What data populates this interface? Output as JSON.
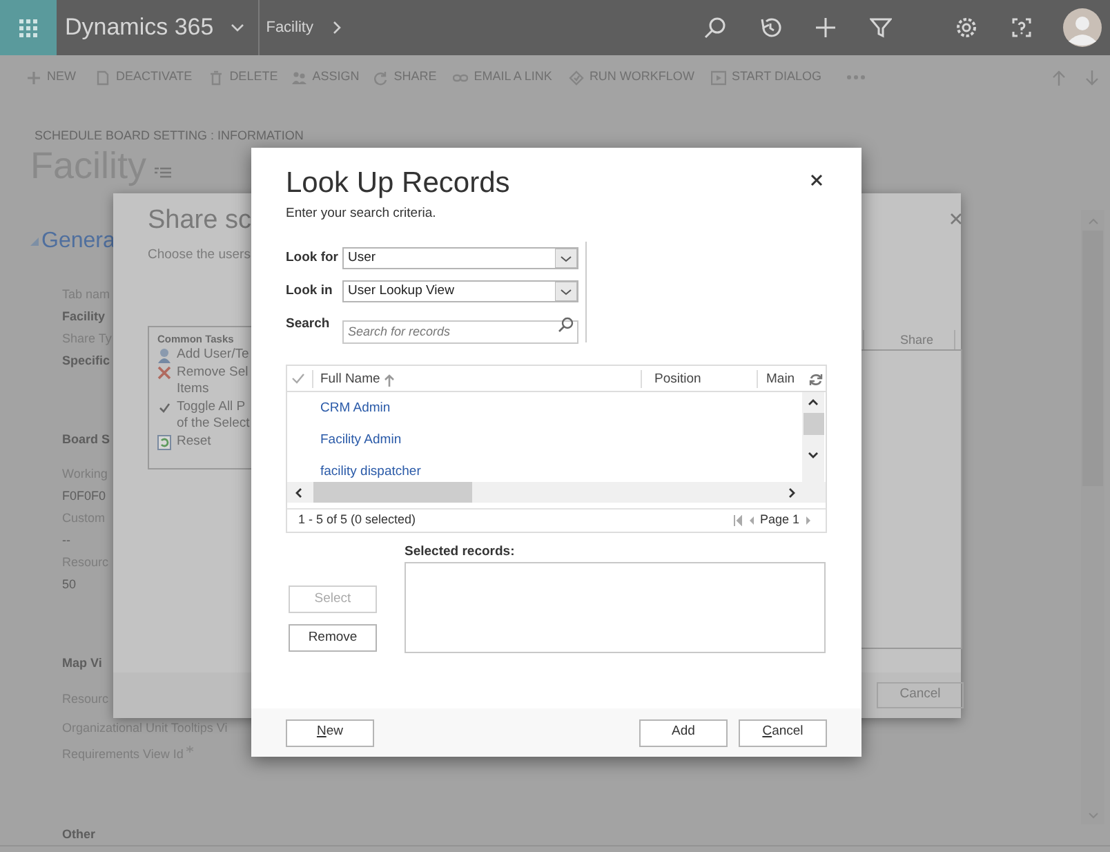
{
  "nav": {
    "app_title": "Dynamics 365",
    "breadcrumb": "Facility"
  },
  "command_bar": [
    {
      "label": "NEW"
    },
    {
      "label": "DEACTIVATE"
    },
    {
      "label": "DELETE"
    },
    {
      "label": "ASSIGN"
    },
    {
      "label": "SHARE"
    },
    {
      "label": "EMAIL A LINK"
    },
    {
      "label": "RUN WORKFLOW"
    },
    {
      "label": "START DIALOG"
    }
  ],
  "record": {
    "entity": "SCHEDULE BOARD SETTING : INFORMATION",
    "title": "Facility",
    "section": "Genera"
  },
  "form_fields": [
    {
      "text": "Tab nam",
      "kind": "label"
    },
    {
      "text": "Facility",
      "kind": "value"
    },
    {
      "text": "Share Ty",
      "kind": "label"
    },
    {
      "text": "Specific",
      "kind": "value"
    },
    {
      "text": "Board S",
      "kind": "heading"
    },
    {
      "text": "Working",
      "kind": "label"
    },
    {
      "text": "F0F0F0",
      "kind": "plain"
    },
    {
      "text": "Custom",
      "kind": "label"
    },
    {
      "text": "--",
      "kind": "plain"
    },
    {
      "text": "Resourc",
      "kind": "label"
    },
    {
      "text": "50",
      "kind": "plain"
    },
    {
      "text": "Map Vi",
      "kind": "heading"
    },
    {
      "text": "Resourc",
      "kind": "label"
    },
    {
      "text": "Organizational Unit Tooltips Vi",
      "kind": "label"
    },
    {
      "text": "Requirements View Id",
      "kind": "required"
    },
    {
      "text": "Other",
      "kind": "heading"
    }
  ],
  "share_dialog": {
    "title": "Share sc",
    "instruction": "Choose the users",
    "common_tasks": {
      "title": "Common Tasks",
      "items": [
        {
          "lines": [
            "Add User/Te"
          ]
        },
        {
          "lines": [
            "Remove Sel",
            "Items"
          ]
        },
        {
          "lines": [
            "Toggle All P",
            "of the Select"
          ]
        },
        {
          "lines": [
            "Reset"
          ]
        }
      ]
    },
    "column_header": "Share",
    "cancel": "Cancel"
  },
  "lookup_dialog": {
    "title": "Look Up Records",
    "instruction": "Enter your search criteria.",
    "look_for": {
      "label": "Look for",
      "value": "User"
    },
    "look_in": {
      "label": "Look in",
      "value": "User Lookup View"
    },
    "search": {
      "label": "Search",
      "placeholder": "Search for records"
    },
    "columns": [
      {
        "label": "Full Name",
        "sorted_ascending": true
      },
      {
        "label": "Position",
        "sorted_ascending": false
      },
      {
        "label": "Main",
        "sorted_ascending": false
      }
    ],
    "rows": [
      {
        "full_name": "CRM Admin"
      },
      {
        "full_name": "Facility Admin"
      },
      {
        "full_name": "facility dispatcher"
      }
    ],
    "record_count": "1 - 5 of 5 (0 selected)",
    "page": "Page 1",
    "selected_label": "Selected records:",
    "side_buttons": [
      {
        "label": "Select",
        "disabled": true
      },
      {
        "label": "Remove",
        "disabled": false
      }
    ],
    "footer_buttons": [
      {
        "label": "New",
        "mnemonic": true
      },
      {
        "label": "Add",
        "mnemonic": false
      },
      {
        "label": "Cancel",
        "mnemonic": true
      }
    ]
  }
}
